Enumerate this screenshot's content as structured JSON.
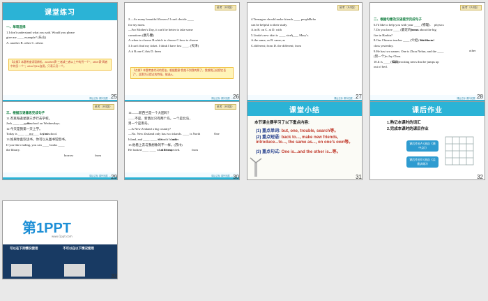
{
  "slides": [
    {
      "num": "25",
      "title": "课堂练习",
      "tag": "易考（A4版）",
      "section": "一、单项选择",
      "lines": [
        "1.I don't understand what you said. Would you please",
        "give me ____ example? (乐山)",
        "A. another        B. other        C. others"
      ],
      "note": "【点拨】本题考查词语辨析。another表“三者或三者以上中的另一个”；other表“两者中的另一个”；other与the连用，只表示另一个。",
      "footer": "课后达标  课外拓展  ……"
    },
    {
      "num": "26",
      "tag": "易考（A4版）",
      "lines": [
        "2.—So many beautiful flowers! I can't decide ____",
        "   for my mom.",
        "  —For Mother's Day, it can't be better to take some",
        "   carnations.(康乃馨)",
        "  A.when to choose   B.which to choose  C.how to choose",
        "3.I can't find my ticket. I think I have lost ____. (天津)",
        "  A.it     B.one    C.this    D. them"
      ],
      "note": "【点拨】本题考查代词的用法。根据题意“我找不到我的票了，我想我已经把它丢了”，此票为已提过的特指，故选A。",
      "footer": "课后达标  课外拓展  ……"
    },
    {
      "num": "27",
      "tag": "易考（A4版）",
      "lines": [
        "4.Teenagers should make friends ____ people who",
        "   can be helpful to their study.",
        "   A.in    B. on    C. at   D. with",
        "5.Linda's new skirt is ____ size ____ Mary's.",
        "   A.the same; as        B. same; as",
        "   C.different; from        D. the different; from"
      ],
      "answers": [
        "D",
        "A"
      ],
      "footer": "课后达标  课外拓展  ……"
    },
    {
      "num": "28",
      "tag": "易考（A4版）",
      "section": "二、根据句意及汉语提示完成句子",
      "lines": [
        "6.I'd like to help you with your ____ (物理).",
        "7.Do you have ____ (最近的)news about the big",
        "   fire in Harbin?",
        "8.Our Chinese teacher ____ (介绍) Mo Yan in",
        "   class yesterday.",
        "9.He has two names. One is Zhou Nelun, and the ____",
        "   (另一个)is Jay Chou.",
        "10.It is ____ (如此)exciting news that he jumps up",
        "   out of bed."
      ],
      "answers": [
        "physics",
        "recent",
        "introduced",
        "other",
        "such"
      ],
      "footer": "课后达标  课外拓展  ……"
    },
    {
      "num": "29",
      "tag": "易考（A4版）",
      "section": "三、根据汉语意思完成句子",
      "lines": [
        "11.杰克每逢星期三步行去学校。",
        "   Jack ____ ____ to school on Wednesdays.",
        "12.今天是我第一天上学。",
        "   Today is ____ ____ ____ day at school.",
        "13.如果你喜欢读书，你可以从图书馆借书。",
        "   If you like reading, you can ____ books ____",
        "   the library."
      ],
      "answers": [
        "walks",
        "my",
        "first",
        "borrow",
        "from"
      ],
      "footer": "课后达标  课外拓展  ……"
    },
    {
      "num": "30",
      "tag": "易考（A4版）",
      "lines": [
        "14.——新西兰是一个大国吗？",
        "   ——不是，新西兰只有两个岛，一个是北岛，",
        "        另一个是南岛。",
        "   —Is New Zealand a big country?",
        "   —No. New Zealand only has two islands. ____ is North",
        "   Island, and ____ ____ is South Island.",
        "15.他看上去与我想象的不一样。(苏州)",
        "   He looked ____ ____ what I'd expected."
      ],
      "answers": [
        "One",
        "the",
        "other",
        "different",
        "from"
      ],
      "footer": "课后达标  课外拓展  ……"
    },
    {
      "num": "31",
      "title": "课堂小结",
      "intro": "本节课主要学习了以下重点内容:",
      "items": [
        {
          "label": "(1) 重点单词:",
          "text": "but, one, trouble, search等。"
        },
        {
          "label": "(2) 重点短语:",
          "text": "back to..., make new friends, introduce...to..., the same as..., on one's own等。"
        },
        {
          "label": "(3) 重点句式:",
          "text": "One is...and the other is...等。"
        }
      ]
    },
    {
      "num": "32",
      "title": "课后作业",
      "items": [
        "1.熟记本课时的词汇",
        "2.完成本课时的课后作业"
      ],
      "pill1": "课后作业A (选自《典中点》)",
      "pill2": "课后作业B (选自《点拨训练》)"
    },
    {
      "num": "33",
      "brand": "第1PPT",
      "url": "www.1ppt.com",
      "left_caption": "可以在下列情况使用",
      "right_caption": "不可以在以下情况使用"
    }
  ]
}
